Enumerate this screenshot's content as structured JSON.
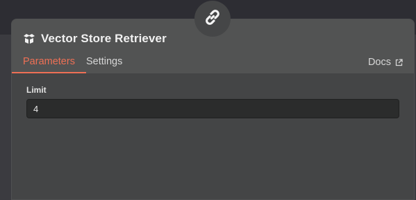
{
  "node": {
    "title": "Vector Store Retriever",
    "icon": "box-open-icon"
  },
  "tabs": [
    {
      "label": "Parameters",
      "active": true
    },
    {
      "label": "Settings",
      "active": false
    }
  ],
  "docs": {
    "label": "Docs",
    "icon": "external-link-icon"
  },
  "fields": {
    "limit": {
      "label": "Limit",
      "value": "4"
    }
  },
  "connector": {
    "icon": "link-icon"
  },
  "colors": {
    "accent": "#ef7055",
    "panel_bg": "#444546",
    "header_bg": "#525353",
    "input_bg": "#2b2c2c"
  }
}
